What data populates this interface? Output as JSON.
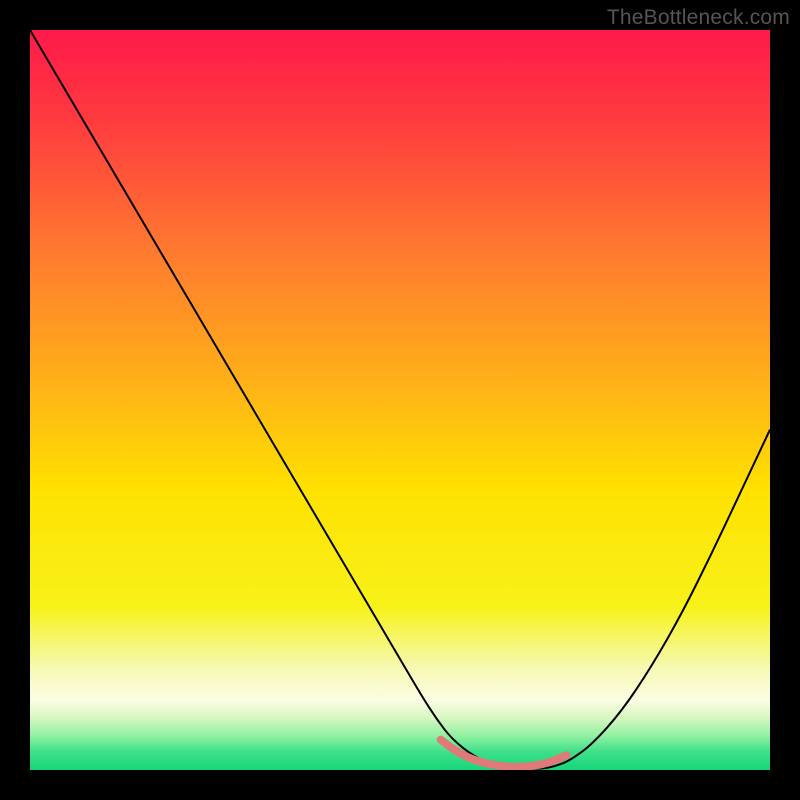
{
  "watermark": "TheBottleneck.com",
  "chart_data": {
    "type": "line",
    "title": "",
    "xlabel": "",
    "ylabel": "",
    "xlim": [
      0,
      100
    ],
    "ylim": [
      0,
      100
    ],
    "background_gradient": {
      "stops": [
        {
          "offset": 0.0,
          "color": "#ff1a4b"
        },
        {
          "offset": 0.12,
          "color": "#ff3a3f"
        },
        {
          "offset": 0.3,
          "color": "#ff7a2f"
        },
        {
          "offset": 0.48,
          "color": "#ffb218"
        },
        {
          "offset": 0.62,
          "color": "#ffe100"
        },
        {
          "offset": 0.78,
          "color": "#f7f21a"
        },
        {
          "offset": 0.86,
          "color": "#f6f9b0"
        },
        {
          "offset": 0.905,
          "color": "#fbfde2"
        },
        {
          "offset": 0.93,
          "color": "#d6f7c0"
        },
        {
          "offset": 0.955,
          "color": "#8cf0a0"
        },
        {
          "offset": 0.975,
          "color": "#3fe08a"
        },
        {
          "offset": 1.0,
          "color": "#16d67a"
        }
      ]
    },
    "series": [
      {
        "name": "bottleneck-curve",
        "color": "#000000",
        "width": 2,
        "x": [
          0.0,
          5,
          10,
          15,
          20,
          25,
          30,
          35,
          40,
          45,
          50,
          53,
          55,
          57,
          60,
          63,
          66,
          69,
          71,
          73,
          76,
          80,
          84,
          88,
          92,
          96,
          100
        ],
        "y": [
          100,
          91.5,
          83,
          74.5,
          66,
          57.5,
          49,
          40.5,
          32,
          23.5,
          15,
          9.9,
          6.8,
          4.2,
          1.8,
          0.6,
          0.15,
          0.15,
          0.5,
          1.3,
          3.5,
          8,
          14,
          21,
          29,
          37.5,
          46
        ]
      },
      {
        "name": "sweet-spot-band",
        "color": "#e07a78",
        "width": 8,
        "linecap": "round",
        "x": [
          55.5,
          58,
          61,
          64,
          67,
          70,
          72.5
        ],
        "y": [
          4.1,
          2.2,
          1.0,
          0.45,
          0.4,
          0.9,
          2.0
        ]
      }
    ]
  }
}
